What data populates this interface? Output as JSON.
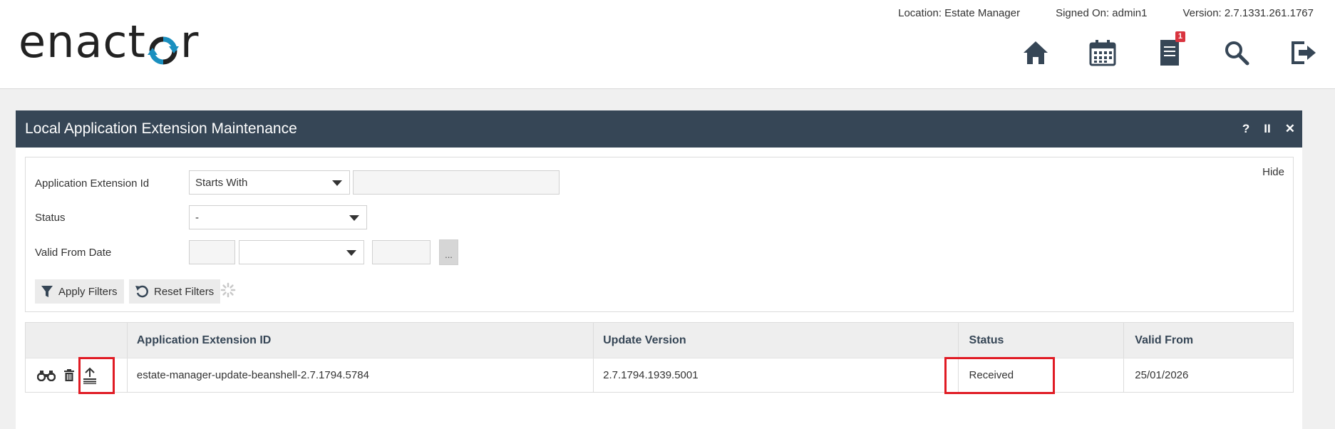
{
  "header": {
    "logo_text_left": "enact",
    "logo_text_right": "r",
    "location": "Location: Estate Manager",
    "signed_on": "Signed On: admin1",
    "version": "Version: 2.7.1331.261.1767",
    "notification_count": "1",
    "icons": [
      "home-icon",
      "calendar-icon",
      "document-icon",
      "search-icon",
      "logout-icon"
    ]
  },
  "panel": {
    "title": "Local Application Extension Maintenance",
    "help": "?",
    "pause": "II",
    "close": "✕"
  },
  "filters": {
    "hide_label": "Hide",
    "app_ext_id_label": "Application Extension Id",
    "app_ext_id_operator": "Starts With",
    "app_ext_id_value": "",
    "status_label": "Status",
    "status_value": "-",
    "valid_from_label": "Valid From Date",
    "valid_from_day": "",
    "valid_from_month": "",
    "valid_from_year": "",
    "date_picker_label": "...",
    "apply_label": "Apply Filters",
    "reset_label": "Reset Filters"
  },
  "table": {
    "columns": [
      "",
      "Application Extension ID",
      "Update Version",
      "Status",
      "Valid From"
    ],
    "rows": [
      {
        "app_ext_id": "estate-manager-update-beanshell-2.7.1794.5784",
        "update_version": "2.7.1794.1939.5001",
        "status": "Received",
        "valid_from": "25/01/2026"
      }
    ]
  },
  "colors": {
    "panel_header": "#364656",
    "highlight": "#e01b24",
    "badge": "#d9343f",
    "logo_accent": "#1a8fbf"
  }
}
